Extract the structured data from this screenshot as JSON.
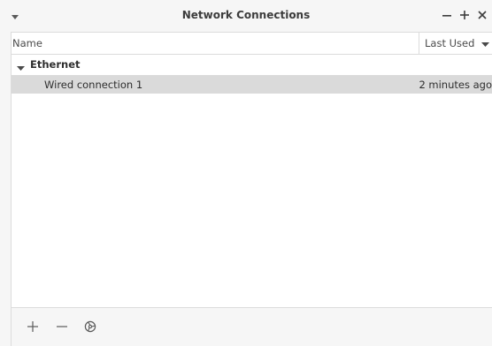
{
  "window": {
    "title": "Network Connections"
  },
  "list": {
    "columns": {
      "name": "Name",
      "last_used": "Last Used"
    },
    "groups": [
      {
        "label": "Ethernet",
        "expanded": true,
        "connections": [
          {
            "name": "Wired connection 1",
            "last_used": "2 minutes ago",
            "selected": true
          }
        ]
      }
    ]
  },
  "icons": {
    "window_menu": "chevron-down-icon",
    "minimize": "minimize-icon",
    "maximize": "maximize-icon",
    "close": "close-icon",
    "sort": "sort-descending-icon",
    "expander": "expander-open-icon",
    "add": "add-icon",
    "remove": "remove-icon",
    "settings": "gear-icon"
  },
  "colors": {
    "selection": "#dadada",
    "window_bg": "#f6f6f6",
    "list_bg": "#ffffff"
  }
}
